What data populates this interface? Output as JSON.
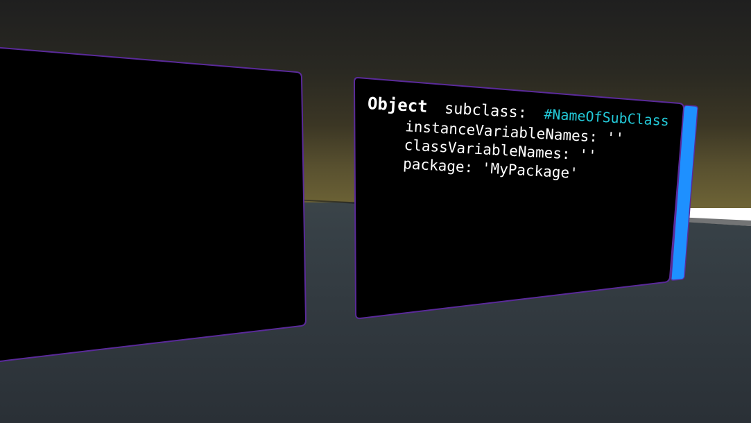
{
  "editor": {
    "line1": {
      "keyword": "Object",
      "selector": "subclass:",
      "symbol": "#NameOfSubClass"
    },
    "line2": "instanceVariableNames: ''",
    "line3": "classVariableNames: ''",
    "line4": "package: 'MyPackage'"
  },
  "colors": {
    "panel_border": "#5a2a9a",
    "panel_background": "#000000",
    "scrollbar": "#1e90ff",
    "symbol": "#23c9d8"
  }
}
